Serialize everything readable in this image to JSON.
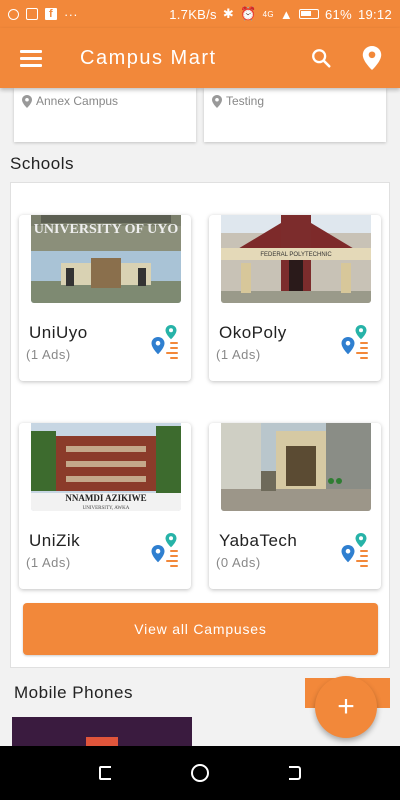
{
  "status_bar": {
    "speed": "1.7KB/s",
    "dots": "···",
    "network": "4G",
    "battery": "61%",
    "time": "19:12"
  },
  "app_bar": {
    "title": "Campus Mart"
  },
  "top_cards": [
    {
      "location": "Annex Campus"
    },
    {
      "location": "Testing"
    }
  ],
  "schools": {
    "title": "Schools",
    "items": [
      {
        "name": "UniUyo",
        "ads": "(1 Ads)",
        "image_text": "UNIVERSITY OF UYO"
      },
      {
        "name": "OkoPoly",
        "ads": "(1 Ads)",
        "image_text": "FEDERAL POLYTECHNIC"
      },
      {
        "name": "UniZik",
        "ads": "(1 Ads)",
        "image_text": "NNAMDI AZIKIWE",
        "image_subtext": "UNIVERSITY, AWKA"
      },
      {
        "name": "YabaTech",
        "ads": "(0 Ads)"
      }
    ],
    "view_all_label": "View all Campuses"
  },
  "mobile_phones": {
    "title": "Mobile Phones"
  },
  "fab": {
    "label": "+"
  },
  "colors": {
    "accent": "#f2883a",
    "pin_blue": "#2f7fd0",
    "pin_teal": "#27b3a8"
  }
}
